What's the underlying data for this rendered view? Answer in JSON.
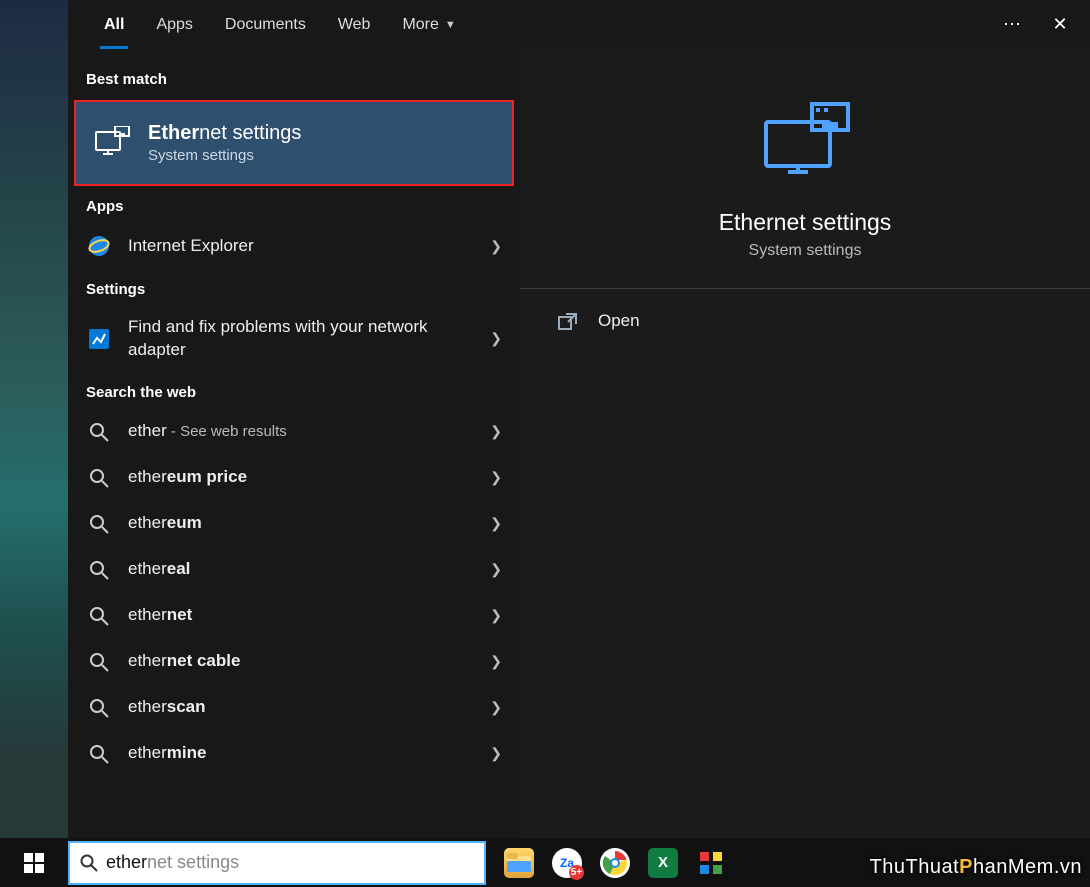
{
  "tabs": {
    "all": "All",
    "apps": "Apps",
    "documents": "Documents",
    "web": "Web",
    "more": "More"
  },
  "sections": {
    "best_match": "Best match",
    "apps": "Apps",
    "settings": "Settings",
    "search_web": "Search the web"
  },
  "best_match": {
    "title_bold": "Ether",
    "title_rest": "net settings",
    "subtitle": "System settings"
  },
  "apps_results": {
    "ie": "Internet Explorer"
  },
  "settings_results": {
    "fix_network": "Find and fix problems with your network adapter"
  },
  "web_results": [
    {
      "pre": "ether",
      "bold": "",
      "suffix": " - See web results"
    },
    {
      "pre": "ether",
      "bold": "eum price",
      "suffix": ""
    },
    {
      "pre": "ether",
      "bold": "eum",
      "suffix": ""
    },
    {
      "pre": "ether",
      "bold": "eal",
      "suffix": ""
    },
    {
      "pre": "ether",
      "bold": "net",
      "suffix": ""
    },
    {
      "pre": "ether",
      "bold": "net cable",
      "suffix": ""
    },
    {
      "pre": "ether",
      "bold": "scan",
      "suffix": ""
    },
    {
      "pre": "ether",
      "bold": "mine",
      "suffix": ""
    }
  ],
  "preview": {
    "title": "Ethernet settings",
    "subtitle": "System settings",
    "open": "Open"
  },
  "search": {
    "typed": "ether",
    "ghost": "net settings"
  },
  "watermark": "ThuThuatPhanMem.vn"
}
